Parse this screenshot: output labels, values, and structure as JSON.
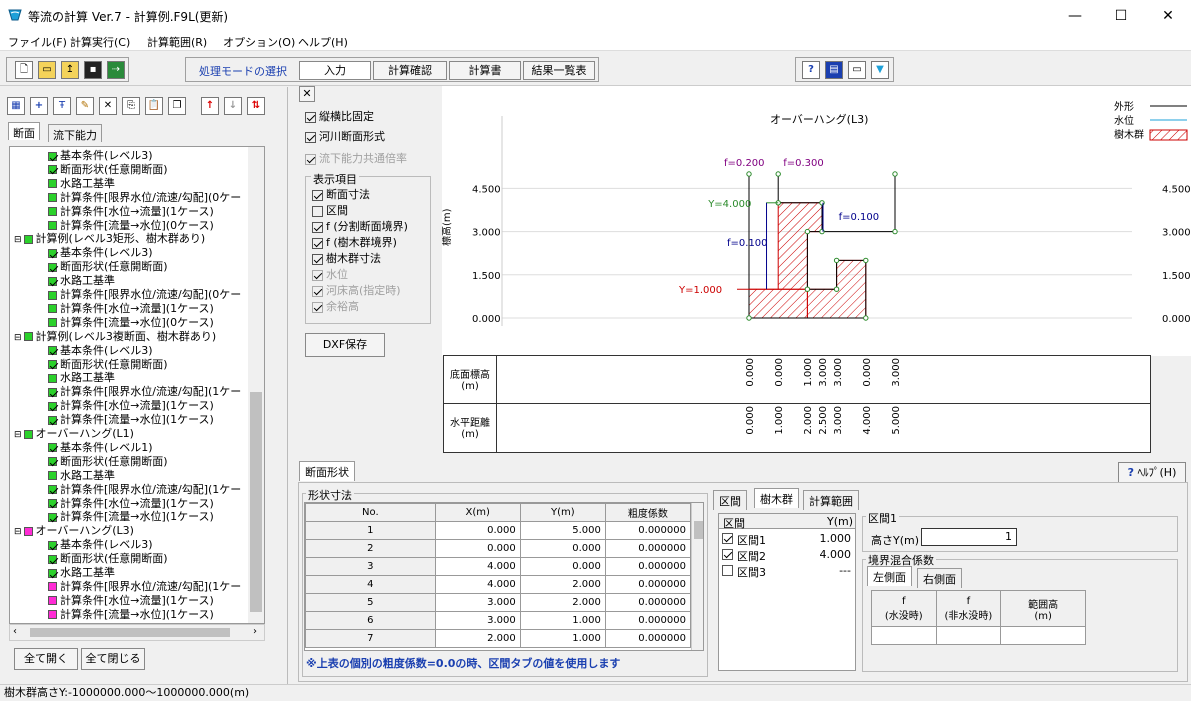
{
  "window": {
    "title": "等流の計算 Ver.7 - 計算例.F9L(更新)",
    "minimize": "—",
    "maximize": "☐",
    "close": "✕"
  },
  "menu": [
    "ファイル(F)",
    "計算実行(C)",
    "計算範囲(R)",
    "オプション(O)",
    "ヘルプ(H)"
  ],
  "toolbar": {
    "mode_label": "処理モードの選択",
    "modes": [
      "入力",
      "計算確認",
      "計算書",
      "結果一覧表"
    ]
  },
  "left": {
    "tabs": [
      "断面",
      "流下能力"
    ],
    "tree": [
      {
        "level": 2,
        "box": "gchk",
        "label": "基本条件(レベル3)"
      },
      {
        "level": 2,
        "box": "gchk",
        "label": "断面形状(任意開断面)"
      },
      {
        "level": 2,
        "box": "g",
        "label": "水路工基準"
      },
      {
        "level": 2,
        "box": "g",
        "label": "計算条件[限界水位/流速/勾配](0ケー"
      },
      {
        "level": 2,
        "box": "g",
        "label": "計算条件[水位→流量](1ケース)"
      },
      {
        "level": 2,
        "box": "g",
        "label": "計算条件[流量→水位](0ケース)"
      },
      {
        "level": 1,
        "box": "g",
        "label": "計算例(レベル3矩形、樹木群あり)"
      },
      {
        "level": 2,
        "box": "gchk",
        "label": "基本条件(レベル3)"
      },
      {
        "level": 2,
        "box": "gchk",
        "label": "断面形状(任意開断面)"
      },
      {
        "level": 2,
        "box": "gchk",
        "label": "水路工基準"
      },
      {
        "level": 2,
        "box": "g",
        "label": "計算条件[限界水位/流速/勾配](0ケー"
      },
      {
        "level": 2,
        "box": "g",
        "label": "計算条件[水位→流量](1ケース)"
      },
      {
        "level": 2,
        "box": "g",
        "label": "計算条件[流量→水位](0ケース)"
      },
      {
        "level": 1,
        "box": "g",
        "label": "計算例(レベル3複断面、樹木群あり)"
      },
      {
        "level": 2,
        "box": "gchk",
        "label": "基本条件(レベル3)"
      },
      {
        "level": 2,
        "box": "gchk",
        "label": "断面形状(任意開断面)"
      },
      {
        "level": 2,
        "box": "g",
        "label": "水路工基準"
      },
      {
        "level": 2,
        "box": "gchk",
        "label": "計算条件[限界水位/流速/勾配](1ケー"
      },
      {
        "level": 2,
        "box": "gchk",
        "label": "計算条件[水位→流量](1ケース)"
      },
      {
        "level": 2,
        "box": "gchk",
        "label": "計算条件[流量→水位](1ケース)"
      },
      {
        "level": 1,
        "box": "g",
        "label": "オーバーハング(L1)"
      },
      {
        "level": 2,
        "box": "gchk",
        "label": "基本条件(レベル1)"
      },
      {
        "level": 2,
        "box": "gchk",
        "label": "断面形状(任意開断面)"
      },
      {
        "level": 2,
        "box": "g",
        "label": "水路工基準"
      },
      {
        "level": 2,
        "box": "gchk",
        "label": "計算条件[限界水位/流速/勾配](1ケー"
      },
      {
        "level": 2,
        "box": "gchk",
        "label": "計算条件[水位→流量](1ケース)"
      },
      {
        "level": 2,
        "box": "gchk",
        "label": "計算条件[流量→水位](1ケース)"
      },
      {
        "level": 1,
        "box": "m",
        "label": "オーバーハング(L3)"
      },
      {
        "level": 2,
        "box": "gchk",
        "label": "基本条件(レベル3)"
      },
      {
        "level": 2,
        "box": "gchk",
        "label": "断面形状(任意開断面)"
      },
      {
        "level": 2,
        "box": "gchk",
        "label": "水路工基準"
      },
      {
        "level": 2,
        "box": "m",
        "label": "計算条件[限界水位/流速/勾配](1ケー"
      },
      {
        "level": 2,
        "box": "m",
        "label": "計算条件[水位→流量](1ケース)"
      },
      {
        "level": 2,
        "box": "m",
        "label": "計算条件[流量→水位](1ケース)"
      }
    ],
    "expand_all": "全て開く",
    "collapse_all": "全て閉じる"
  },
  "options": {
    "close_x": "✕",
    "aspect_fixed": "縦横比固定",
    "river_section": "河川断面形式",
    "common_ratio": "流下能力共通倍率",
    "display_group": "表示項目",
    "items": [
      {
        "label": "断面寸法",
        "checked": true,
        "disabled": false
      },
      {
        "label": "区間",
        "checked": false,
        "disabled": false
      },
      {
        "label": "f (分割断面境界)",
        "checked": true,
        "disabled": false
      },
      {
        "label": "f (樹木群境界)",
        "checked": true,
        "disabled": false
      },
      {
        "label": "樹木群寸法",
        "checked": true,
        "disabled": false
      },
      {
        "label": "水位",
        "checked": true,
        "disabled": true
      },
      {
        "label": "河床高(指定時)",
        "checked": true,
        "disabled": true
      },
      {
        "label": "余裕高",
        "checked": true,
        "disabled": true
      }
    ],
    "dxf_button": "DXF保存"
  },
  "chart": {
    "title": "オーバーハング(L3)",
    "ylabel": "標高(m)",
    "yticks": [
      "4.500",
      "3.000",
      "1.500",
      "0.000"
    ],
    "legend": {
      "outline": "外形",
      "water": "水位",
      "trees": "樹木群"
    },
    "annotations": {
      "f1": "f=0.200",
      "f2": "f=0.300",
      "f3": "f=0.100",
      "f4": "f=0.100",
      "y4": "Y=4.000",
      "y1": "Y=1.000"
    }
  },
  "chart_data": {
    "type": "line",
    "title": "オーバーハング(L3)",
    "xlabel": "",
    "ylabel": "標高(m)",
    "ylim": [
      0,
      5.0
    ],
    "series": [
      {
        "name": "外形",
        "x": [
          0.0,
          0.0,
          4.0,
          4.0,
          3.0,
          3.0,
          2.0,
          2.0,
          2.5,
          2.5,
          1.0,
          1.0,
          5.0,
          5.0
        ],
        "y": [
          5.0,
          0.0,
          0.0,
          2.0,
          2.0,
          1.0,
          1.0,
          3.0,
          3.0,
          4.0,
          4.0,
          5.0,
          3.0,
          5.0
        ]
      }
    ]
  },
  "data_table": {
    "row1_label": "底面標高\n(m)",
    "row2_label": "水平距離\n(m)",
    "row1_values": [
      "0.000",
      "0.000",
      "1.000",
      "3.000",
      "3.000",
      "0.000",
      "3.000"
    ],
    "row2_values": [
      "0.000",
      "1.000",
      "2.000",
      "2.500",
      "3.000",
      "4.000",
      "5.000"
    ]
  },
  "bottom": {
    "tab": "断面形状",
    "help": "ﾍﾙﾌﾟ(H)",
    "shape_group": "形状寸法",
    "headers": [
      "No.",
      "X(m)",
      "Y(m)",
      "粗度係数"
    ],
    "rows": [
      [
        "1",
        "0.000",
        "5.000",
        "0.000000"
      ],
      [
        "2",
        "0.000",
        "0.000",
        "0.000000"
      ],
      [
        "3",
        "4.000",
        "0.000",
        "0.000000"
      ],
      [
        "4",
        "4.000",
        "2.000",
        "0.000000"
      ],
      [
        "5",
        "3.000",
        "2.000",
        "0.000000"
      ],
      [
        "6",
        "3.000",
        "1.000",
        "0.000000"
      ],
      [
        "7",
        "2.000",
        "1.000",
        "0.000000"
      ]
    ],
    "note": "※上表の個別の粗度係数=0.0の時、区間タブの値を使用します",
    "sub_tabs": [
      "区間",
      "樹木群",
      "計算範囲"
    ],
    "section_headers": [
      "区間",
      "Y(m)"
    ],
    "sections": [
      {
        "label": "区間1",
        "checked": true,
        "y": "1.000"
      },
      {
        "label": "区間2",
        "checked": true,
        "y": "4.000"
      },
      {
        "label": "区間3",
        "checked": false,
        "y": "---"
      }
    ],
    "section_group": "区間1",
    "height_label": "高さY(m)",
    "height_value": "1",
    "mix_group": "境界混合係数",
    "mix_tabs": [
      "左側面",
      "右側面"
    ],
    "mix_headers": [
      "f\n(水没時)",
      "f\n(非水没時)",
      "範囲高\n(m)"
    ]
  },
  "status": "樹木群高さY:-1000000.000～1000000.000(m)"
}
